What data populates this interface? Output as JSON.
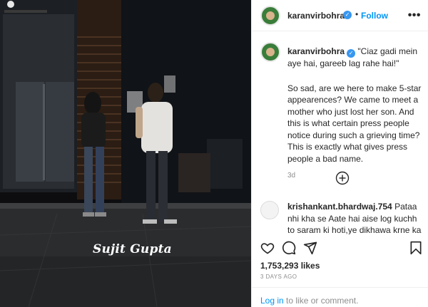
{
  "post": {
    "username": "karanvirbohra",
    "follow_label": "Follow",
    "dot_separator": "•",
    "more_label": "•••",
    "watermark": "Sujit Gupta"
  },
  "caption": {
    "username": "karanvirbohra",
    "title": "\"Ciaz gadi mein aye hai, gareeb lag rahe hai!\"",
    "body": "So sad, are we here to make 5-star appearences? We came to meet a mother who just lost her son. And this is what certain press people notice during such a grieving time? This is exactly what gives press people a bad name.",
    "age": "3d"
  },
  "comments": [
    {
      "username": "krishankant.bhardwaj.754",
      "text": "Pataa nhi kha se Aate hai aise log kuchh to saram ki hoti,ye dikhawa krne ka waqt"
    }
  ],
  "stats": {
    "likes": "1,753,293 likes",
    "date": "3 DAYS AGO"
  },
  "footer": {
    "login_link": "Log in",
    "login_rest": " to like or comment."
  },
  "icons": {
    "verified": "verified-badge-icon",
    "like": "heart-icon",
    "comment": "comment-icon",
    "share": "share-icon",
    "save": "bookmark-icon",
    "load_more": "plus-circle-icon"
  },
  "colors": {
    "accent": "#0095f6",
    "verified": "#3897f0",
    "muted": "#8e8e8e",
    "text": "#262626"
  }
}
